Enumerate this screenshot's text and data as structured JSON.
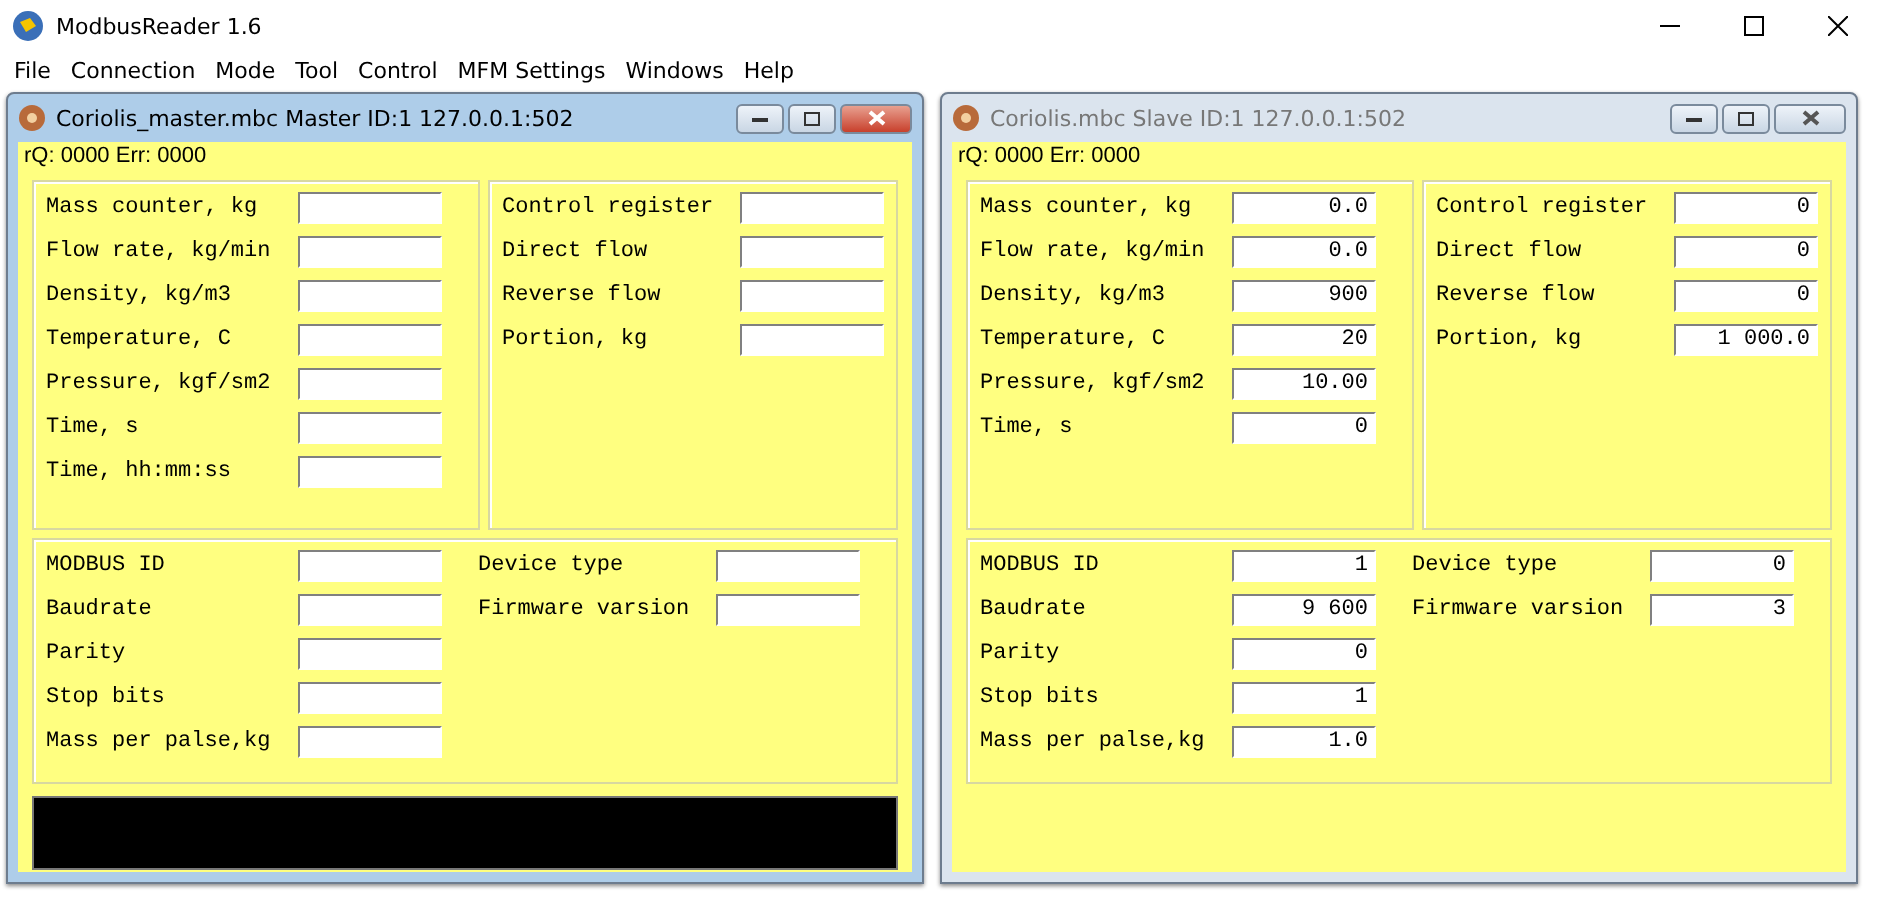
{
  "app": {
    "title": "ModbusReader 1.6"
  },
  "menu": [
    "File",
    "Connection",
    "Mode",
    "Tool",
    "Control",
    "MFM Settings",
    "Windows",
    "Help"
  ],
  "windows": [
    {
      "title": "Coriolis_master.mbc Master ID:1 127.0.0.1:502",
      "active": true,
      "status": "rQ: 0000 Err: 0000",
      "log_bar": true,
      "measurements": [
        {
          "label": "Mass counter, kg"
        },
        {
          "label": "Flow rate, kg/min"
        },
        {
          "label": "Density, kg/m3"
        },
        {
          "label": "Temperature, C"
        },
        {
          "label": "Pressure, kgf/sm2"
        },
        {
          "label": "Time, s"
        },
        {
          "label": "Time, hh:mm:ss"
        }
      ],
      "controls": [
        {
          "label": "Control register"
        },
        {
          "label": "Direct flow"
        },
        {
          "label": "Reverse flow"
        },
        {
          "label": "Portion, kg"
        }
      ],
      "settings": [
        {
          "label": "MODBUS ID"
        },
        {
          "label": "Baudrate"
        },
        {
          "label": "Parity"
        },
        {
          "label": "Stop bits"
        },
        {
          "label": "Mass per palse,kg"
        }
      ],
      "device": [
        {
          "label": "Device type"
        },
        {
          "label": "Firmware varsion"
        }
      ]
    },
    {
      "title": "Coriolis.mbc Slave ID:1 127.0.0.1:502",
      "active": false,
      "status": "rQ: 0000 Err: 0000",
      "log_bar": false,
      "measurements": [
        {
          "label": "Mass counter, kg",
          "value": "0.0"
        },
        {
          "label": "Flow rate, kg/min",
          "value": "0.0"
        },
        {
          "label": "Density, kg/m3",
          "value": "900"
        },
        {
          "label": "Temperature, C",
          "value": "20"
        },
        {
          "label": "Pressure, kgf/sm2",
          "value": "10.00"
        },
        {
          "label": "Time, s",
          "value": "0"
        }
      ],
      "controls": [
        {
          "label": "Control register",
          "value": "0"
        },
        {
          "label": "Direct flow",
          "value": "0"
        },
        {
          "label": "Reverse flow",
          "value": "0"
        },
        {
          "label": "Portion, kg",
          "value": "1 000.0"
        }
      ],
      "settings": [
        {
          "label": "MODBUS ID",
          "value": "1"
        },
        {
          "label": "Baudrate",
          "value": "9 600"
        },
        {
          "label": "Parity",
          "value": "0"
        },
        {
          "label": "Stop bits",
          "value": "1"
        },
        {
          "label": "Mass per palse,kg",
          "value": "1.0"
        }
      ],
      "device": [
        {
          "label": "Device type",
          "value": "0"
        },
        {
          "label": "Firmware varsion",
          "value": "3"
        }
      ]
    }
  ]
}
